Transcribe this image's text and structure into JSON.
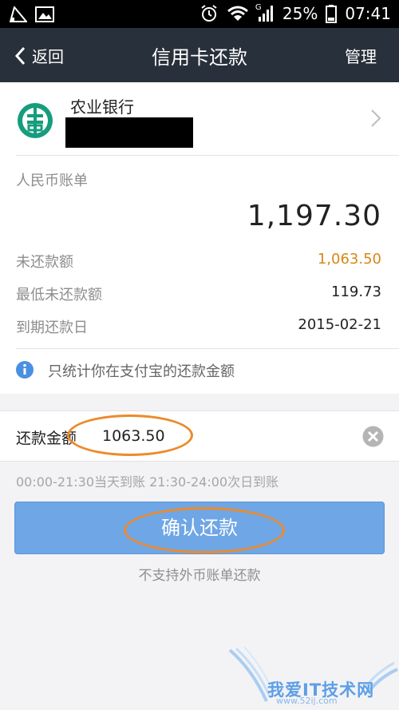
{
  "status_bar": {
    "signal_type": "G",
    "battery": "25%",
    "time": "07:41"
  },
  "header": {
    "back_label": "返回",
    "title": "信用卡还款",
    "manage_label": "管理"
  },
  "card": {
    "bank_name": "农业银行",
    "bill_type": "人民币账单",
    "total": "1,197.30",
    "rows": [
      {
        "label": "未还款额",
        "value": "1,063.50"
      },
      {
        "label": "最低未还款额",
        "value": "119.73"
      },
      {
        "label": "到期还款日",
        "value": "2015-02-21"
      }
    ],
    "info": "只统计你在支付宝的还款金额"
  },
  "payment": {
    "label": "还款金额",
    "amount": "1063.50"
  },
  "hint": "00:00-21:30当天到账  21:30-24:00次日到账",
  "confirm_label": "确认还款",
  "footnote": "不支持外币账单还款",
  "watermark": {
    "text": "我爱IT技术网",
    "url": "www.52ij.com"
  },
  "colors": {
    "header_bg": "#28303b",
    "button_bg": "#6fa6e6",
    "highlight": "#d68814",
    "annotation": "#ec8a2b",
    "info_icon": "#4a90e2"
  }
}
